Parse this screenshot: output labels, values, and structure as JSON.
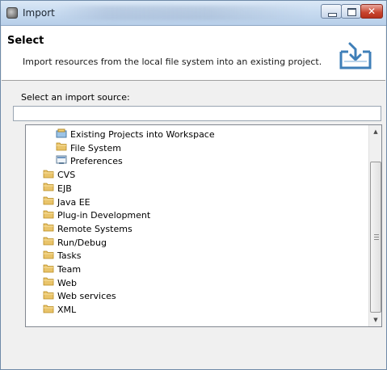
{
  "window": {
    "title": "Import",
    "app_icon": "eclipse-icon",
    "controls": [
      "minimize-icon",
      "maximize-icon",
      "close-icon"
    ]
  },
  "banner": {
    "title": "Select",
    "description": "Import resources from the local file system into an existing project.",
    "icon": "import-wizard-icon"
  },
  "source": {
    "label": "Select an import source:",
    "filter_value": "",
    "filter_placeholder": ""
  },
  "tree": {
    "items": [
      {
        "label": "Existing Projects into Workspace",
        "icon": "projects-icon",
        "level": 1
      },
      {
        "label": "File System",
        "icon": "folder-icon",
        "level": 1
      },
      {
        "label": "Preferences",
        "icon": "preferences-icon",
        "level": 1
      },
      {
        "label": "CVS",
        "icon": "folder-icon",
        "level": 0
      },
      {
        "label": "EJB",
        "icon": "folder-icon",
        "level": 0
      },
      {
        "label": "Java EE",
        "icon": "folder-icon",
        "level": 0
      },
      {
        "label": "Plug-in Development",
        "icon": "folder-icon",
        "level": 0
      },
      {
        "label": "Remote Systems",
        "icon": "folder-icon",
        "level": 0
      },
      {
        "label": "Run/Debug",
        "icon": "folder-icon",
        "level": 0
      },
      {
        "label": "Tasks",
        "icon": "folder-icon",
        "level": 0
      },
      {
        "label": "Team",
        "icon": "folder-icon",
        "level": 0
      },
      {
        "label": "Web",
        "icon": "folder-icon",
        "level": 0
      },
      {
        "label": "Web services",
        "icon": "folder-icon",
        "level": 0
      },
      {
        "label": "XML",
        "icon": "folder-icon",
        "level": 0
      }
    ]
  },
  "colors": {
    "folder": "#e9c46a",
    "titlebar": "#c8dbf0",
    "close_button": "#c7432d"
  }
}
